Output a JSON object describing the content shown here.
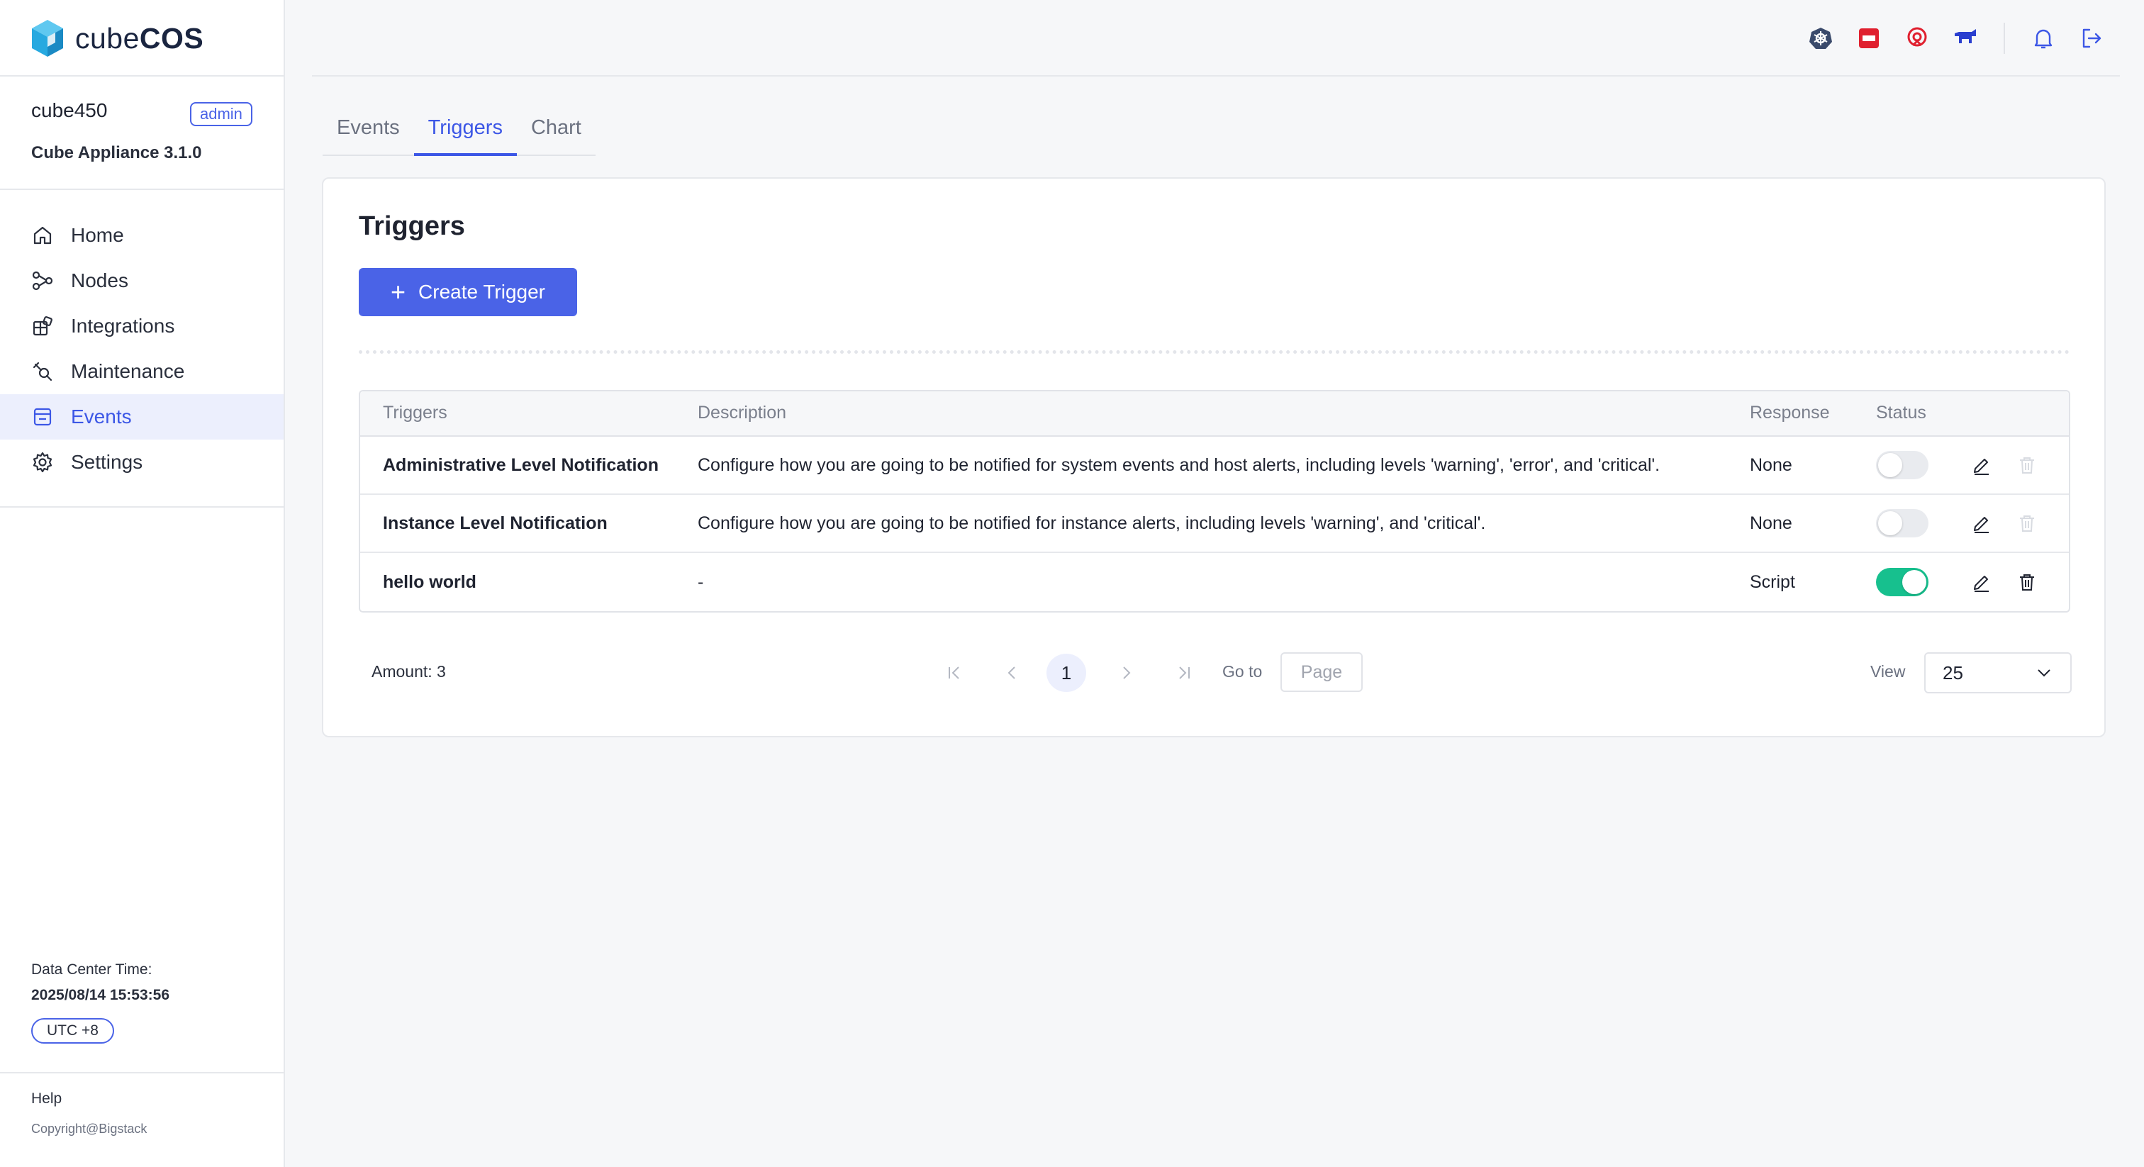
{
  "brand": {
    "name_light": "cube",
    "name_bold": "COS"
  },
  "sidebar": {
    "hostname": "cube450",
    "role_badge": "admin",
    "version": "Cube Appliance 3.1.0",
    "items": [
      {
        "label": "Home",
        "icon": "home-icon"
      },
      {
        "label": "Nodes",
        "icon": "nodes-icon"
      },
      {
        "label": "Integrations",
        "icon": "integrations-icon"
      },
      {
        "label": "Maintenance",
        "icon": "maintenance-icon"
      },
      {
        "label": "Events",
        "icon": "events-icon",
        "active": true
      },
      {
        "label": "Settings",
        "icon": "gear-icon"
      }
    ],
    "dc_time_label": "Data Center Time:",
    "dc_time": "2025/08/14 15:53:56",
    "timezone": "UTC +8",
    "help": "Help",
    "copyright": "Copyright@Bigstack"
  },
  "topbar": {
    "icons": [
      "kubernetes-icon",
      "openstack-icon",
      "ceph-icon",
      "rancher-icon",
      "bell-icon",
      "logout-icon"
    ]
  },
  "tabs": [
    {
      "label": "Events"
    },
    {
      "label": "Triggers",
      "active": true
    },
    {
      "label": "Chart"
    }
  ],
  "main": {
    "title": "Triggers",
    "create_button": "Create Trigger",
    "columns": [
      "Triggers",
      "Description",
      "Response",
      "Status"
    ],
    "rows": [
      {
        "name": "Administrative Level Notification",
        "description": "Configure how you are going to be notified for system events and host alerts, including levels 'warning', 'error', and 'critical'.",
        "response": "None",
        "enabled": false,
        "deletable": false
      },
      {
        "name": "Instance Level Notification",
        "description": "Configure how you are going to be notified for instance alerts, including levels 'warning', and 'critical'.",
        "response": "None",
        "enabled": false,
        "deletable": false
      },
      {
        "name": "hello world",
        "description": "-",
        "response": "Script",
        "enabled": true,
        "deletable": true
      }
    ]
  },
  "pagination": {
    "amount": "Amount: 3",
    "current_page": "1",
    "goto_label": "Go to",
    "page_placeholder": "Page",
    "view_label": "View",
    "view_value": "25"
  },
  "colors": {
    "accent": "#4a63e7",
    "toggle_on": "#17c08e",
    "openstack": "#e0202f",
    "ceph": "#e0202f",
    "rancher": "#2a3fcf",
    "kubernetes": "#3a4a6b"
  }
}
